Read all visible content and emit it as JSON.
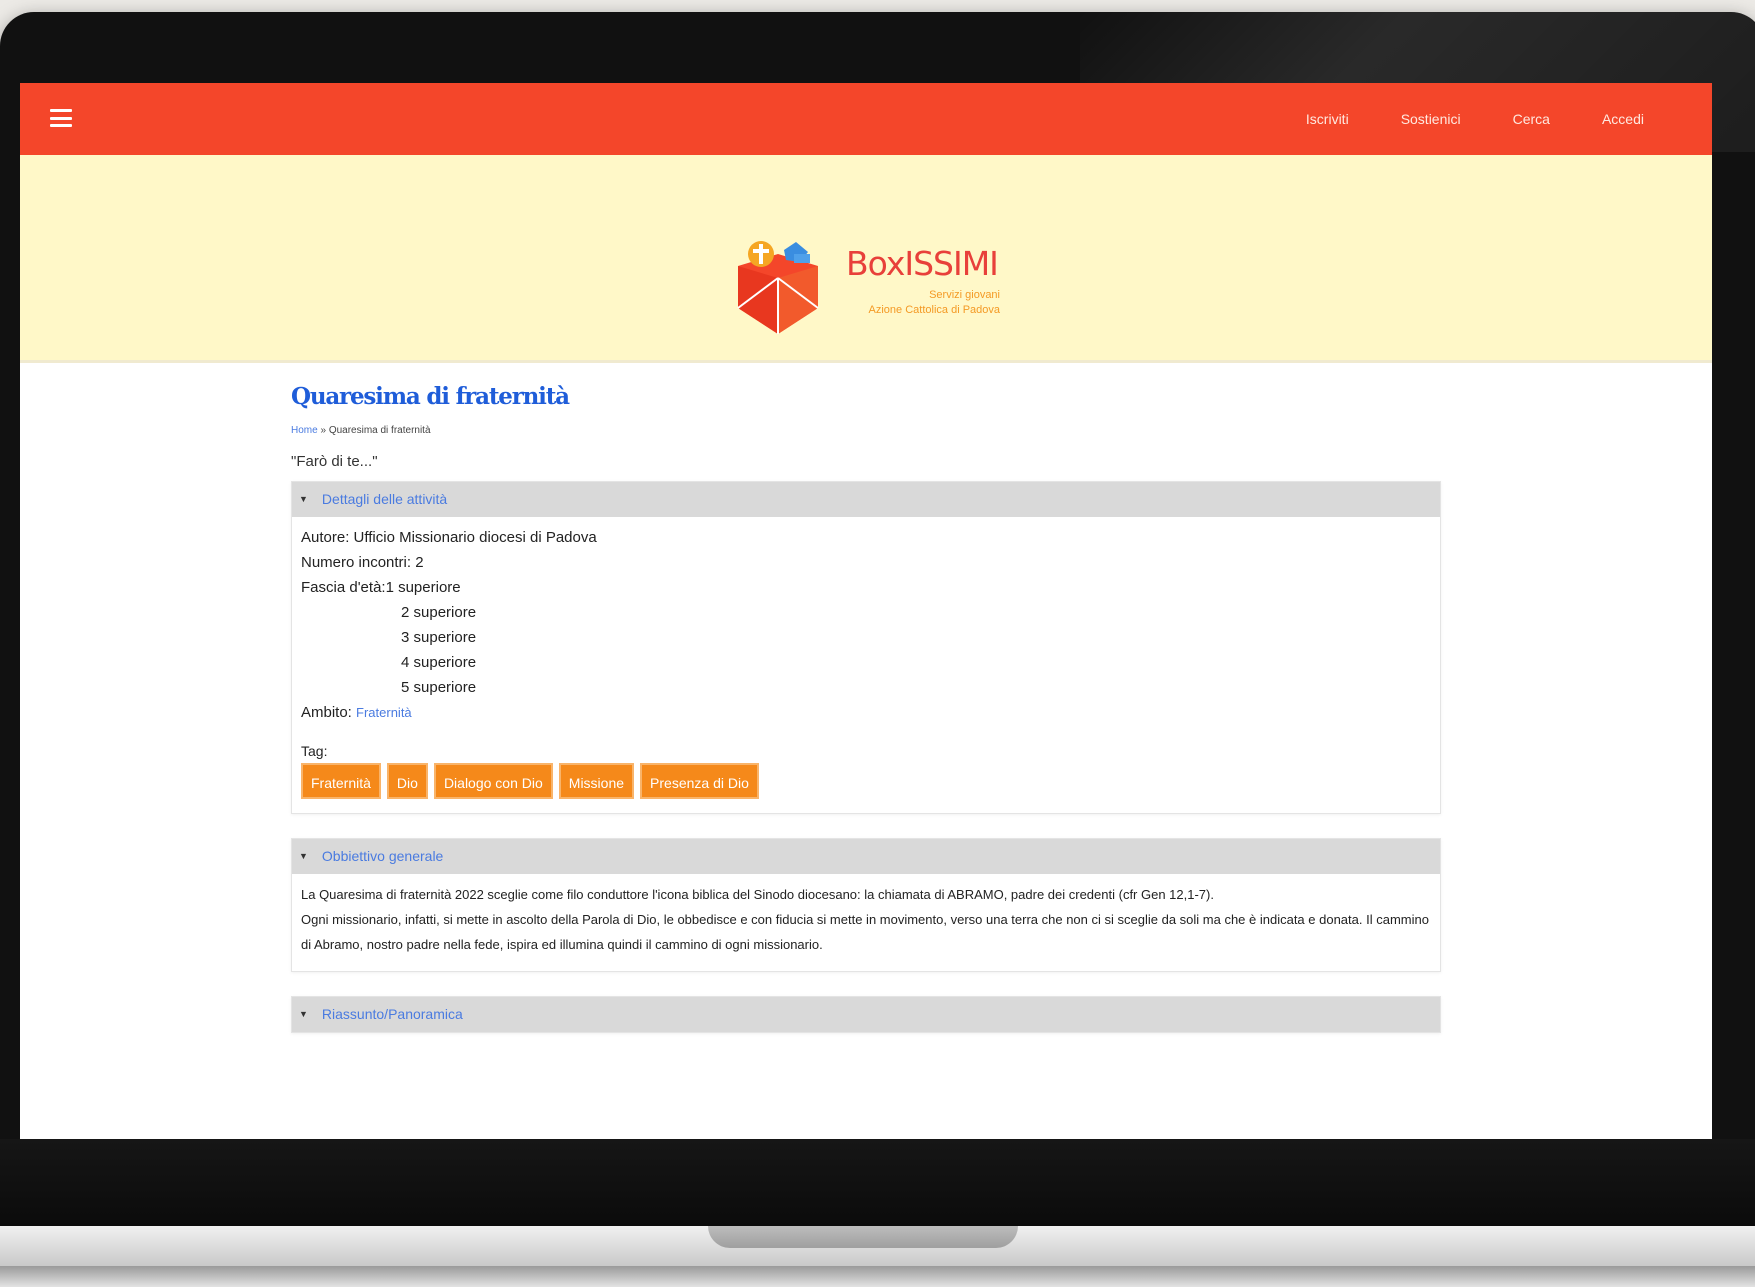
{
  "navbar": {
    "links": [
      "Iscriviti",
      "Sostienici",
      "Cerca",
      "Accedi"
    ]
  },
  "logo": {
    "title": "BoxISSIMI",
    "subtitle1": "Servizi giovani",
    "subtitle2": "Azione Cattolica di Padova"
  },
  "page": {
    "title": "Quaresima di fraternità",
    "breadcrumb_home": "Home",
    "breadcrumb_sep": " » ",
    "breadcrumb_current": "Quaresima di fraternità",
    "quote": "\"Farò di te...\""
  },
  "details": {
    "header": "Dettagli delle attività",
    "author": "Autore: Ufficio Missionario diocesi di Padova",
    "meetings": "Numero incontri: 2",
    "age_label": "Fascia d'età: ",
    "ages": [
      "1 superiore",
      "2 superiore",
      "3 superiore",
      "4 superiore",
      "5 superiore"
    ],
    "scope_label": "Ambito: ",
    "scope_link": "Fraternità",
    "tags_label": "Tag:",
    "tags": [
      "Fraternità",
      "Dio",
      "Dialogo con Dio",
      "Missione",
      "Presenza di Dio"
    ]
  },
  "objective": {
    "header": "Obbiettivo generale",
    "p1": "La Quaresima di fraternità 2022 sceglie come filo conduttore l'icona biblica del Sinodo diocesano: la chiamata di ABRAMO, padre dei credenti (cfr Gen 12,1-7).",
    "p2": "Ogni missionario, infatti, si mette in ascolto della Parola di Dio, le obbedisce e con fiducia si mette in movimento, verso una terra che non ci si sceglie da soli ma che è indicata e donata. Il cammino di Abramo, nostro padre nella fede, ispira ed illumina quindi il cammino di ogni missionario."
  },
  "overview": {
    "header": "Riassunto/Panoramica"
  },
  "colors": {
    "navbar": "#f4462a",
    "banner": "#fff8c8",
    "title_blue": "#1f5dd9",
    "tag_orange": "#f5891a"
  }
}
